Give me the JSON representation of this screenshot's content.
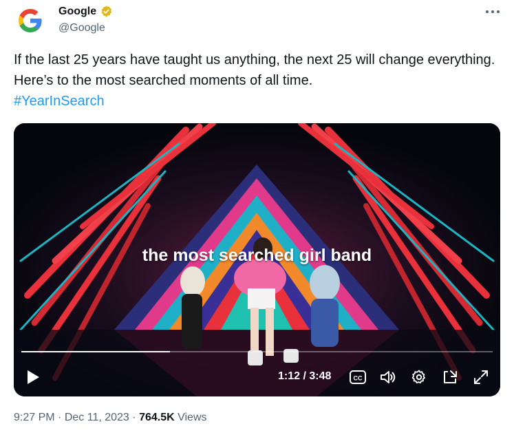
{
  "author": {
    "name": "Google",
    "handle": "@Google",
    "avatar_icon": "google-g-logo",
    "verified_icon": "verified-badge-gold",
    "verified_color": "#e2b719"
  },
  "more_icon": "more-horizontal-icon",
  "tweet": {
    "text": "If the last 25 years have taught us anything, the next 25 will change everything. Here’s to the most searched moments of all time.",
    "hashtag": "#YearInSearch"
  },
  "video": {
    "caption": "the most searched girl band",
    "time_display": "1:12 / 3:48",
    "progress_percent": 31.6,
    "controls": {
      "play_icon": "play-icon",
      "cc_icon": "closed-captions-icon",
      "cc_label": "CC",
      "volume_icon": "volume-icon",
      "settings_icon": "gear-icon",
      "pip_icon": "picture-in-picture-icon",
      "fullscreen_icon": "fullscreen-expand-icon"
    }
  },
  "meta": {
    "time": "9:27 PM",
    "separator": "·",
    "date": "Dec 11, 2023",
    "views_count": "764.5K",
    "views_label": "Views"
  },
  "colors": {
    "accent": "#1d9bf0",
    "text": "#0f1419",
    "secondary": "#536471"
  }
}
